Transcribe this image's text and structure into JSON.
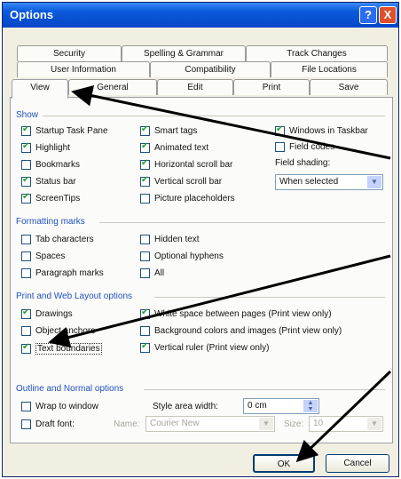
{
  "window": {
    "title": "Options",
    "help_glyph": "?",
    "close_glyph": "X"
  },
  "tabs": {
    "row1": [
      "Security",
      "Spelling & Grammar",
      "Track Changes"
    ],
    "row2": [
      "User Information",
      "Compatibility",
      "File Locations"
    ],
    "row3": [
      "View",
      "General",
      "Edit",
      "Print",
      "Save"
    ],
    "active": "View"
  },
  "show": {
    "title": "Show",
    "items": [
      {
        "label": "Startup Task Pane",
        "checked": true
      },
      {
        "label": "Highlight",
        "checked": true
      },
      {
        "label": "Bookmarks",
        "checked": false
      },
      {
        "label": "Status bar",
        "checked": true
      },
      {
        "label": "ScreenTips",
        "checked": true
      },
      {
        "label": "Smart tags",
        "checked": true
      },
      {
        "label": "Animated text",
        "checked": true
      },
      {
        "label": "Horizontal scroll bar",
        "checked": true
      },
      {
        "label": "Vertical scroll bar",
        "checked": true
      },
      {
        "label": "Picture placeholders",
        "checked": false
      },
      {
        "label": "Windows in Taskbar",
        "checked": true
      },
      {
        "label": "Field codes",
        "checked": false
      }
    ],
    "field_shading_label": "Field shading:",
    "field_shading_value": "When selected"
  },
  "formatting": {
    "title": "Formatting marks",
    "items": [
      {
        "label": "Tab characters",
        "checked": false
      },
      {
        "label": "Spaces",
        "checked": false
      },
      {
        "label": "Paragraph marks",
        "checked": false
      },
      {
        "label": "Hidden text",
        "checked": false
      },
      {
        "label": "Optional hyphens",
        "checked": false
      },
      {
        "label": "All",
        "checked": false
      }
    ]
  },
  "print_layout": {
    "title": "Print and Web Layout options",
    "items": [
      {
        "label": "Drawings",
        "checked": true
      },
      {
        "label": "Object anchors",
        "checked": false
      },
      {
        "label": "Text boundaries",
        "checked": true
      },
      {
        "label": "White space between pages (Print view only)",
        "checked": true
      },
      {
        "label": "Background colors and images (Print view only)",
        "checked": false
      },
      {
        "label": "Vertical ruler (Print view only)",
        "checked": true
      }
    ]
  },
  "outline": {
    "title": "Outline and Normal options",
    "items": [
      {
        "label": "Wrap to window",
        "checked": false
      },
      {
        "label": "Draft font:",
        "checked": false
      }
    ],
    "style_area_label": "Style area width:",
    "style_area_value": "0 cm",
    "name_label": "Name:",
    "name_value": "Courier New",
    "size_label": "Size:",
    "size_value": "10"
  },
  "buttons": {
    "ok": "OK",
    "cancel": "Cancel"
  },
  "colors": {
    "titlebar": "#0645c6",
    "group_title": "#2050c0",
    "check": "#21a121",
    "arrow": "#000000"
  }
}
